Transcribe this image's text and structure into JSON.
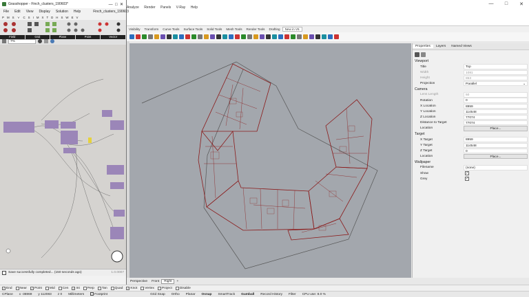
{
  "rhino": {
    "menu": [
      "Analyze",
      "Render",
      "Panels",
      "V-Ray",
      "Help"
    ],
    "tabs": [
      "Visibility",
      "Transform",
      "Curve Tools",
      "Surface Tools",
      "Solid Tools",
      "Mesh Tools",
      "Render Tools",
      "Drafting",
      "New in V6"
    ],
    "active_tab": "New in V6",
    "viewport_tabs": [
      "Perspective",
      "Front",
      "Right"
    ],
    "active_viewport": "Right",
    "add_tab_glyph": "+"
  },
  "properties": {
    "tabs": [
      "Properties",
      "Layers",
      "Named Views"
    ],
    "viewport_section": "Viewport",
    "viewport_rows": [
      {
        "label": "Title",
        "value": "Top",
        "dim": false
      },
      {
        "label": "Width",
        "value": "1081",
        "dim": true
      },
      {
        "label": "Height",
        "value": "853",
        "dim": true
      },
      {
        "label": "Projection",
        "value": "Parallel",
        "dim": false,
        "dropdown": true
      }
    ],
    "camera_section": "Camera",
    "camera_rows": [
      {
        "label": "Lens Length",
        "value": "50",
        "dim": true
      },
      {
        "label": "Rotation",
        "value": "0",
        "dim": false
      },
      {
        "label": "X Location",
        "value": "8959",
        "dim": false
      },
      {
        "label": "Y Location",
        "value": "114548",
        "dim": false
      },
      {
        "label": "Z Location",
        "value": "77074",
        "dim": false
      },
      {
        "label": "Distance to Target",
        "value": "77074",
        "dim": false
      }
    ],
    "camera_location_label": "Location",
    "place_button": "Place...",
    "target_section": "Target",
    "target_rows": [
      {
        "label": "X Target",
        "value": "8959"
      },
      {
        "label": "Y Target",
        "value": "114548"
      },
      {
        "label": "Z Target",
        "value": "0"
      }
    ],
    "target_location_label": "Location",
    "wallpaper_section": "Wallpaper",
    "filename_label": "Filename",
    "filename_value": "(none)",
    "show_label": "Show",
    "grey_label": "Grey"
  },
  "osnap": [
    "End",
    "Near",
    "Point",
    "Mid",
    "Cen",
    "Int",
    "Perp",
    "Tan",
    "Quad",
    "Knot",
    "Vertex",
    "Project",
    "Disable"
  ],
  "osnap_checked": [
    "End",
    "Point",
    "Int",
    "Knot"
  ],
  "status": {
    "cplane": "CPlane",
    "x": "x -36969",
    "y": "y 112083",
    "z": "z 0",
    "units": "Millimeters",
    "layer": "Footprint",
    "toggles": [
      "Grid Snap",
      "Ortho",
      "Planar",
      "Osnap",
      "SmartTrack",
      "Gumball",
      "Record History",
      "Filter"
    ],
    "bold_toggles": [
      "Osnap",
      "Gumball"
    ],
    "cpu": "CPU use: 8.0 %"
  },
  "grasshopper": {
    "title": "Grasshopper - Finch_clusters_190603*",
    "menu": [
      "File",
      "Edit",
      "View",
      "Display",
      "Solution",
      "Help"
    ],
    "doc_label": "Finch_clusters_190603",
    "category_tabs": [
      "P",
      "M",
      "S",
      "V",
      "C",
      "S",
      "I",
      "M",
      "X",
      "T",
      "D",
      "H",
      "S",
      "W",
      "E",
      "V"
    ],
    "groups": [
      "Field",
      "Grid",
      "Plane",
      "Point",
      "Vector"
    ],
    "zoom": "7%",
    "status_text": "Save successfully completed... (150 seconds ago)",
    "version": "1.0.0007"
  }
}
